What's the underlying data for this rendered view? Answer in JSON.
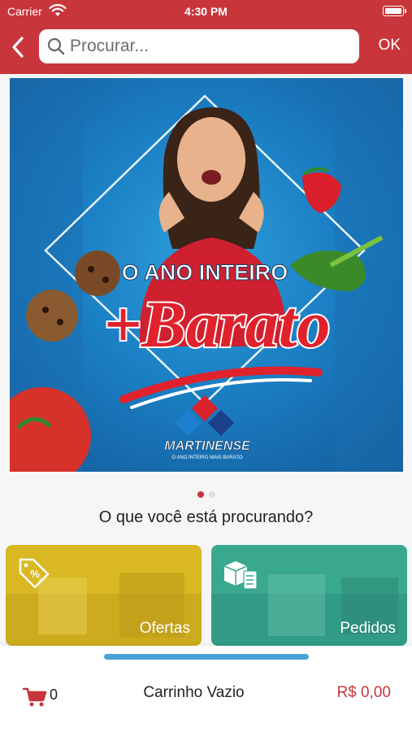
{
  "status_bar": {
    "carrier": "Carrier",
    "time": "4:30 PM"
  },
  "nav": {
    "search_placeholder": "Procurar...",
    "ok_label": "OK"
  },
  "banner": {
    "headline_top": "O ANO INTEIRO",
    "headline_main": "+Barato",
    "brand": "MARTINENSE",
    "brand_tagline": "O ANO INTEIRO MAIS BARATO",
    "pages": 2,
    "active_page": 1
  },
  "question": "O que você está procurando?",
  "cards": [
    {
      "label": "Ofertas",
      "icon": "tag-percent-icon"
    },
    {
      "label": "Pedidos",
      "icon": "boxes-checklist-icon"
    }
  ],
  "cart": {
    "icon": "cart-icon",
    "count": "0",
    "status": "Carrinho Vazio",
    "total": "R$ 0,00"
  },
  "colors": {
    "brand_red": "#c8363c",
    "ofertas_yellow": "#d9b823",
    "pedidos_teal": "#3aa88f",
    "handle_blue": "#47a2d6"
  }
}
